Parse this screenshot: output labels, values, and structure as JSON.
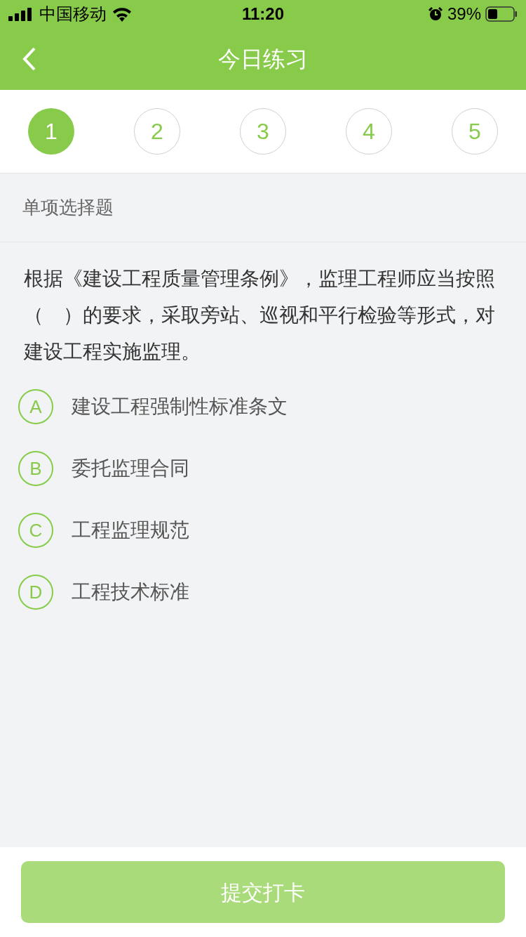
{
  "status_bar": {
    "carrier": "中国移动",
    "time": "11:20",
    "battery": "39%"
  },
  "nav_bar": {
    "title": "今日练习"
  },
  "question_tabs": [
    {
      "label": "1",
      "selected": true
    },
    {
      "label": "2",
      "selected": false
    },
    {
      "label": "3",
      "selected": false
    },
    {
      "label": "4",
      "selected": false
    },
    {
      "label": "5",
      "selected": false
    }
  ],
  "question_type": "单项选择题",
  "question": "根据《建设工程质量管理条例》，监理工程师应当按照（　）的要求，采取旁站、巡视和平行检验等形式，对建设工程实施监理。",
  "options": [
    {
      "letter": "A",
      "text": "建设工程强制性标准条文",
      "selected": false
    },
    {
      "letter": "B",
      "text": "委托监理合同",
      "selected": false
    },
    {
      "letter": "C",
      "text": "工程监理规范",
      "selected": false
    },
    {
      "letter": "D",
      "text": "工程技术标准",
      "selected": false
    }
  ],
  "submit_button": {
    "label": "提交打卡",
    "disabled": true
  }
}
